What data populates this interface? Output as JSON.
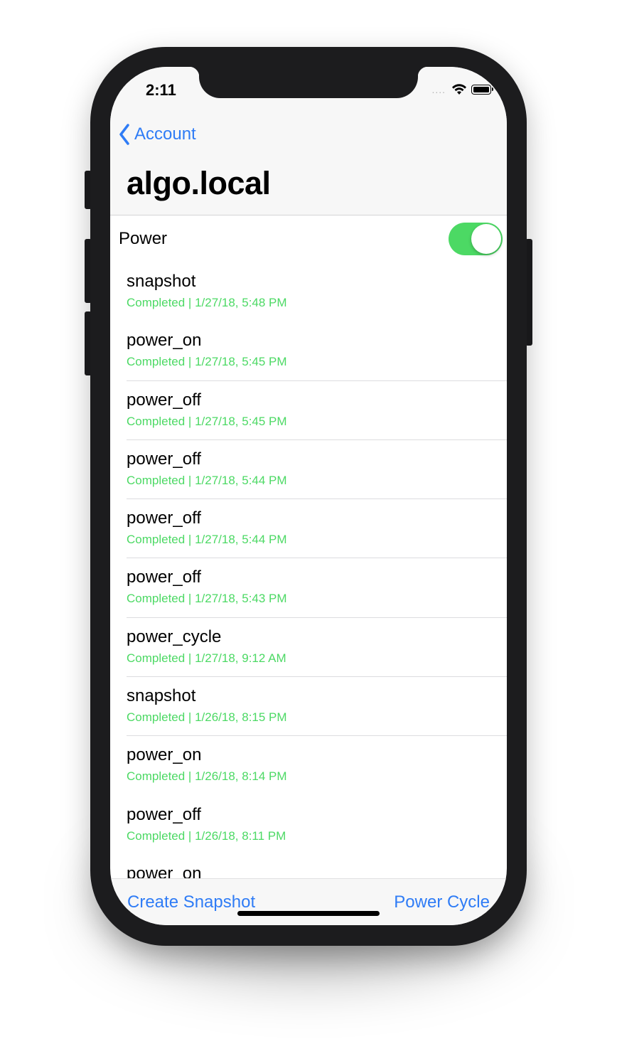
{
  "status_bar": {
    "time": "2:11",
    "signal_dots": "....",
    "wifi_icon": "wifi-icon",
    "battery_icon": "battery-icon"
  },
  "nav": {
    "back_label": "Account",
    "title": "algo.local"
  },
  "power": {
    "label": "Power",
    "toggle_on": true,
    "toggle_color": "#4cd964"
  },
  "tasks": [
    {
      "name": "snapshot",
      "status": "Completed | 1/27/18, 5:48 PM"
    },
    {
      "name": "power_on",
      "status": "Completed | 1/27/18, 5:45 PM"
    },
    {
      "name": "power_off",
      "status": "Completed | 1/27/18, 5:45 PM"
    },
    {
      "name": "power_off",
      "status": "Completed | 1/27/18, 5:44 PM"
    },
    {
      "name": "power_off",
      "status": "Completed | 1/27/18, 5:44 PM"
    },
    {
      "name": "power_off",
      "status": "Completed | 1/27/18, 5:43 PM"
    },
    {
      "name": "power_cycle",
      "status": "Completed | 1/27/18, 9:12 AM"
    },
    {
      "name": "snapshot",
      "status": "Completed | 1/26/18, 8:15 PM"
    },
    {
      "name": "power_on",
      "status": "Completed | 1/26/18, 8:14 PM"
    },
    {
      "name": "power_off",
      "status": "Completed | 1/26/18, 8:11 PM"
    },
    {
      "name": "power_on",
      "status": ""
    }
  ],
  "toolbar": {
    "create_snapshot_label": "Create Snapshot",
    "power_cycle_label": "Power Cycle"
  },
  "colors": {
    "accent": "#2f7cf6",
    "status_green": "#4cd964"
  }
}
